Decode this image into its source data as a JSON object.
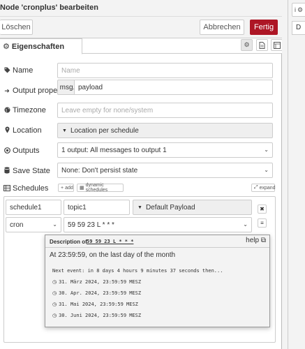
{
  "header": {
    "title": "Node 'cronplus' bearbeiten"
  },
  "actions": {
    "delete": "Löschen",
    "cancel": "Abbrechen",
    "done": "Fertig"
  },
  "tabs": {
    "properties": "Eigenschaften"
  },
  "form": {
    "name": {
      "label": "Name",
      "placeholder": "Name"
    },
    "output_property": {
      "label": "Output property",
      "prefix": "msg.",
      "value": "payload"
    },
    "timezone": {
      "label": "Timezone",
      "placeholder": "Leave empty for none/system"
    },
    "location": {
      "label": "Location",
      "value": "Location per schedule"
    },
    "outputs": {
      "label": "Outputs",
      "value": "1 output: All messages to output 1"
    },
    "save_state": {
      "label": "Save State",
      "value": "None: Don't persist state"
    },
    "schedules": {
      "label": "Schedules",
      "add_label": "add",
      "dynamic_label": "dynamic schedules",
      "expand_label": "expand"
    }
  },
  "schedule": {
    "name": "schedule1",
    "topic": "topic1",
    "payload_type": "Default Payload",
    "type": "cron",
    "expression": "59 59 23 L * * *"
  },
  "popup": {
    "description_label": "Description of",
    "expression": "59 59 23 L * * *",
    "help": "help",
    "summary": "At 23:59:59, on the last day of the month",
    "next_event": "Next event: in 8 days 4 hours 9 minutes 37 seconds then...",
    "dates": [
      "31. März 2024, 23:59:59 MESZ",
      "30. Apr. 2024, 23:59:59 MESZ",
      "31. Mai 2024, 23:59:59 MESZ",
      "30. Juni 2024, 23:59:59 MESZ"
    ]
  },
  "sidebar": {
    "tab_label": "i",
    "tab_partial": "D"
  },
  "icons": {
    "tag": "tag-icon",
    "sign_out": "sign-out-icon",
    "globe": "globe-icon",
    "map_marker": "map-marker-icon",
    "dot_circle": "dot-circle-icon",
    "database": "database-icon",
    "table": "table-icon",
    "clock": "clock-icon"
  },
  "colors": {
    "done_button": "#ad1625",
    "panel_bg": "#f3f3f3"
  }
}
